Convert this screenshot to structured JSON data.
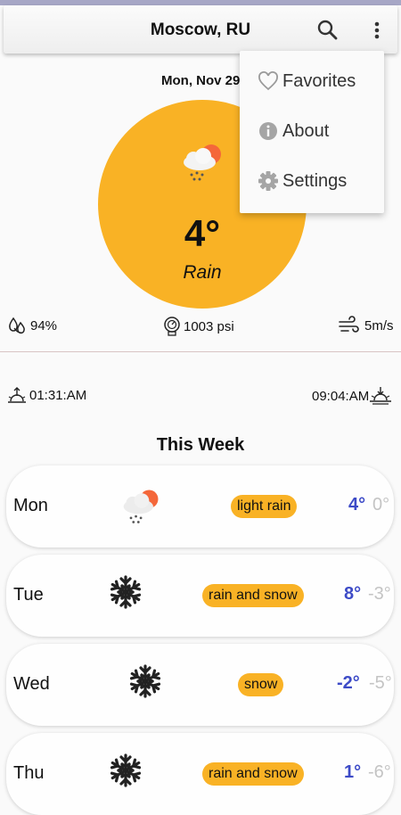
{
  "header": {
    "city": "Moscow, RU",
    "search_icon": "search-icon",
    "more_icon": "more-vert-icon"
  },
  "current": {
    "date": "Mon, Nov 29",
    "temperature": "4°",
    "condition": "Rain",
    "humidity": "94%",
    "pressure": "1003 psi",
    "wind": "5m/s",
    "sunrise": "01:31:AM",
    "sunset": "09:04:AM"
  },
  "week": {
    "title": "This Week",
    "days": [
      {
        "name": "Mon",
        "icon": "rain-sun-icon",
        "desc": "light rain",
        "high": "4°",
        "low": "0°"
      },
      {
        "name": "Tue",
        "icon": "snowflake-icon",
        "desc": "rain and snow",
        "high": "8°",
        "low": "-3°"
      },
      {
        "name": "Wed",
        "icon": "snowflake-icon",
        "desc": "snow",
        "high": "-2°",
        "low": "-5°"
      },
      {
        "name": "Thu",
        "icon": "snowflake-icon",
        "desc": "rain and snow",
        "high": "1°",
        "low": "-6°"
      }
    ]
  },
  "menu": {
    "items": [
      {
        "label": "Favorites",
        "icon": "heart-icon"
      },
      {
        "label": "About",
        "icon": "info-icon"
      },
      {
        "label": "Settings",
        "icon": "gear-icon"
      }
    ]
  },
  "colors": {
    "accent": "#f9b225",
    "high_temp": "#3d4bc7",
    "low_temp": "#c4c4c4"
  }
}
